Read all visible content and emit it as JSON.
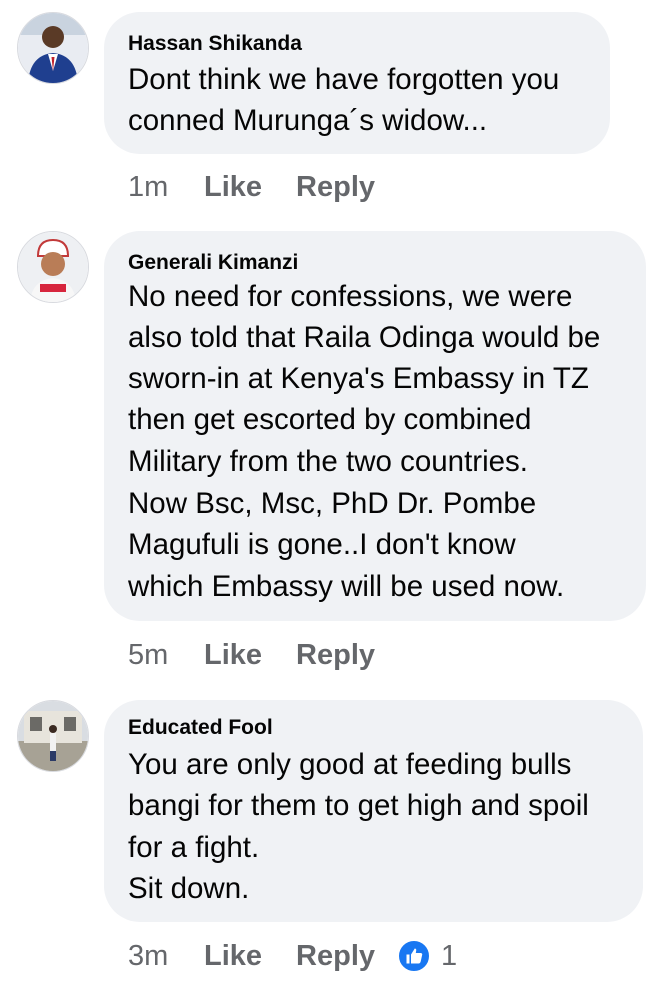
{
  "comments": [
    {
      "author": "Hassan Shikanda",
      "lines": [
        "Dont think we have forgotten you",
        "conned Murunga´s widow..."
      ],
      "time": "1m",
      "like_label": "Like",
      "reply_label": "Reply"
    },
    {
      "author": "Generali Kimanzi",
      "lines": [
        "No need for confessions, we were",
        "also told that Raila Odinga would be",
        "sworn-in at Kenya's Embassy in TZ",
        "then get escorted by combined",
        "Military from the two countries.",
        "Now Bsc, Msc, PhD Dr. Pombe",
        "Magufuli is gone..I don't know",
        "which Embassy will be used now."
      ],
      "time": "5m",
      "like_label": "Like",
      "reply_label": "Reply"
    },
    {
      "author": "Educated Fool",
      "lines": [
        "You are only good at feeding bulls",
        "bangi for them to get high and spoil",
        "for a fight.",
        "Sit down."
      ],
      "time": "3m",
      "like_label": "Like",
      "reply_label": "Reply",
      "reaction": {
        "icon": "thumbs-up-icon",
        "count": "1",
        "color": "#1877f2"
      }
    }
  ]
}
